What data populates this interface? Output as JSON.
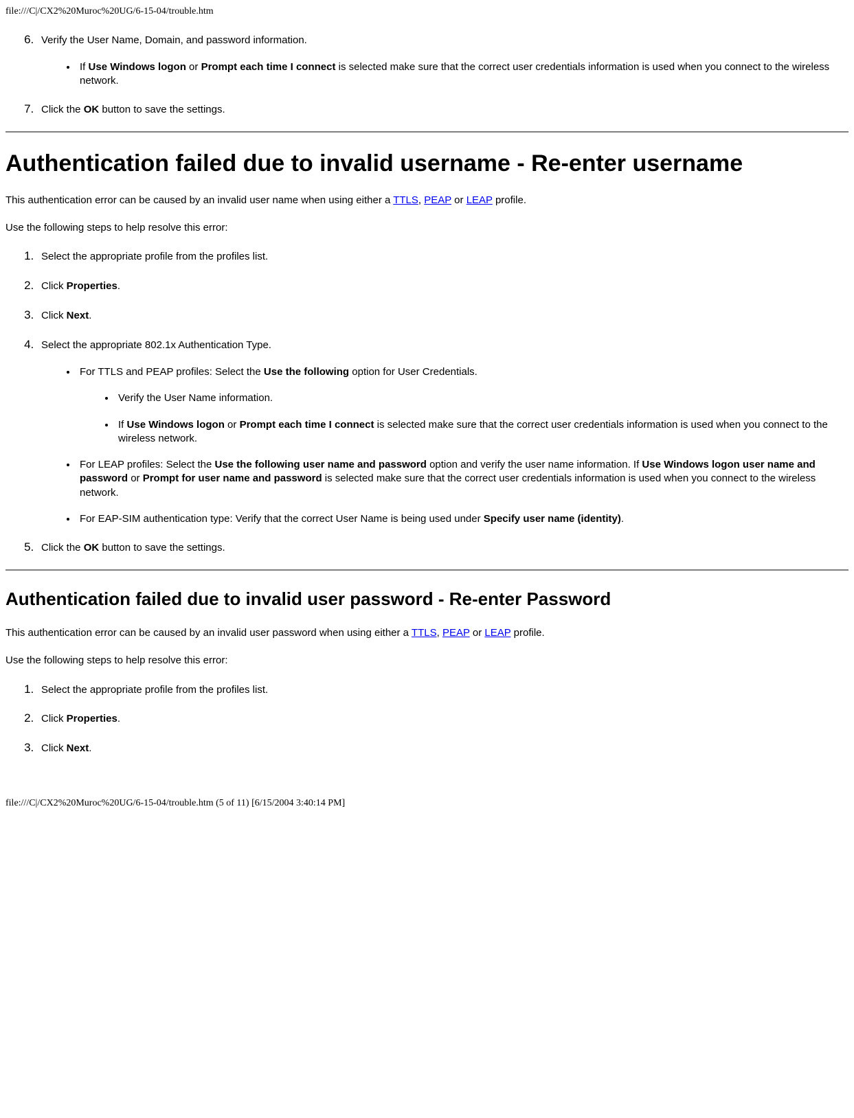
{
  "url_header": "file:///C|/CX2%20Muroc%20UG/6-15-04/trouble.htm",
  "topA": {
    "li6": {
      "text": "Verify the User Name, Domain, and password information.",
      "sub_prefix": "If ",
      "b1": "Use Windows logon",
      "mid1": " or ",
      "b2": "Prompt each time I connect",
      "tail": " is selected make sure that the correct user credentials information is used when you connect to the wireless network."
    },
    "li7": {
      "prefix": "Click the ",
      "bold": "OK",
      "suffix": " button to save the settings."
    }
  },
  "h1": "Authentication failed due to invalid username - Re-enter username",
  "para1": {
    "t1": "This authentication error can be caused by an invalid user name when using either a ",
    "link1": "TTLS",
    "c1": ", ",
    "link2": "PEAP",
    "c2": " or ",
    "link3": "LEAP",
    "tail": " profile."
  },
  "para2": "Use the following steps to help resolve this error:",
  "listB": {
    "l1": "Select the appropriate profile from the profiles list.",
    "l2": {
      "t1": "Click ",
      "b": "Properties",
      "t2": "."
    },
    "l3": {
      "t1": "Click ",
      "b": "Next",
      "t2": "."
    },
    "l4": {
      "text": "Select the appropriate 802.1x Authentication Type.",
      "s1": {
        "t1": "For TTLS and PEAP profiles: Select the ",
        "b": "Use the following",
        "t2": " option for User Credentials."
      },
      "s1a": "Verify the User Name information.",
      "s1b": {
        "t1": "If ",
        "b1": "Use Windows logon",
        "t2": " or ",
        "b2": "Prompt each time I connect",
        "t3": " is selected make sure that the correct user credentials information is used when you connect to the wireless network."
      },
      "s2": {
        "t1": "For LEAP profiles: Select the ",
        "b1": "Use the following user name and password",
        "t2": " option and verify the user name information. If ",
        "b2": "Use Windows logon user name and password",
        "t3": " or ",
        "b3": "Prompt for user name and password",
        "t4": " is selected make sure that the correct user credentials information is used when you connect to the wireless network."
      },
      "s3": {
        "t1": "For EAP-SIM authentication type: Verify that the correct User Name is being used under ",
        "b": "Specify user name (identity)",
        "t2": "."
      }
    },
    "l5": {
      "t1": "Click the ",
      "b": "OK",
      "t2": " button to save the settings."
    }
  },
  "h2": "Authentication failed due to invalid user password - Re-enter Password",
  "para3": {
    "t1": "This authentication error can be caused by an invalid user password when using either a ",
    "link1": "TTLS",
    "c1": ", ",
    "link2": "PEAP",
    "c2": " or ",
    "link3": "LEAP",
    "tail": " profile."
  },
  "para4": "Use the following steps to help resolve this error:",
  "listC": {
    "l1": "Select the appropriate profile from the profiles list.",
    "l2": {
      "t1": "Click ",
      "b": "Properties",
      "t2": "."
    },
    "l3": {
      "t1": "Click ",
      "b": "Next",
      "t2": "."
    }
  },
  "footer": "file:///C|/CX2%20Muroc%20UG/6-15-04/trouble.htm (5 of 11) [6/15/2004 3:40:14 PM]"
}
